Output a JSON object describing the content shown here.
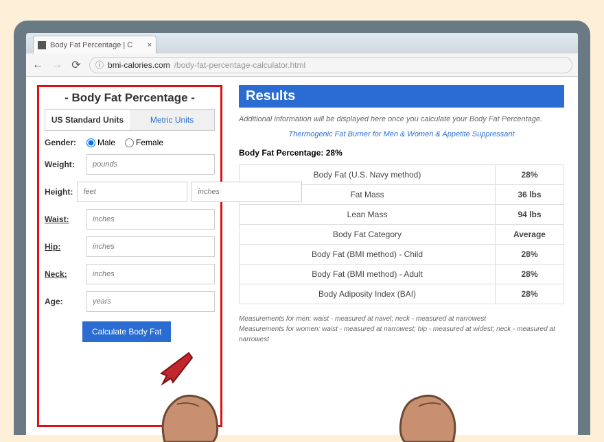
{
  "browser": {
    "tab_title": "Body Fat Percentage | C",
    "domain": "bmi-calories.com",
    "path": "/body-fat-percentage-calculator.html"
  },
  "form": {
    "title": "- Body Fat Percentage -",
    "tab_us": "US Standard Units",
    "tab_metric": "Metric Units",
    "gender_label": "Gender:",
    "gender_male": "Male",
    "gender_female": "Female",
    "weight_label": "Weight:",
    "weight_ph": "pounds",
    "height_label": "Height:",
    "height_ft_ph": "feet",
    "height_in_ph": "inches",
    "waist_label": "Waist:",
    "waist_ph": "inches",
    "hip_label": "Hip:",
    "hip_ph": "inches",
    "neck_label": "Neck:",
    "neck_ph": "inches",
    "age_label": "Age:",
    "age_ph": "years",
    "button": "Calculate Body Fat"
  },
  "results": {
    "heading": "Results",
    "note": "Additional information will be displayed here once you calculate your Body Fat Percentage.",
    "link": "Thermogenic Fat Burner for Men & Women & Appetite Suppressant",
    "summary_label": "Body Fat Percentage:",
    "summary_value": "28%",
    "rows": [
      {
        "label": "Body Fat (U.S. Navy method)",
        "value": "28%"
      },
      {
        "label": "Fat Mass",
        "value": "36 lbs"
      },
      {
        "label": "Lean Mass",
        "value": "94 lbs"
      },
      {
        "label": "Body Fat Category",
        "value": "Average"
      },
      {
        "label": "Body Fat (BMI method) - Child",
        "value": "28%"
      },
      {
        "label": "Body Fat (BMI method) - Adult",
        "value": "28%"
      },
      {
        "label": "Body Adiposity Index (BAI)",
        "value": "28%"
      }
    ],
    "foot1": "Measurements for men: waist - measured at navel; neck - measured at narrowest",
    "foot2": "Measurements for women: waist - measured at narrowest; hip - measured at widest; neck - measured at narrowest"
  }
}
